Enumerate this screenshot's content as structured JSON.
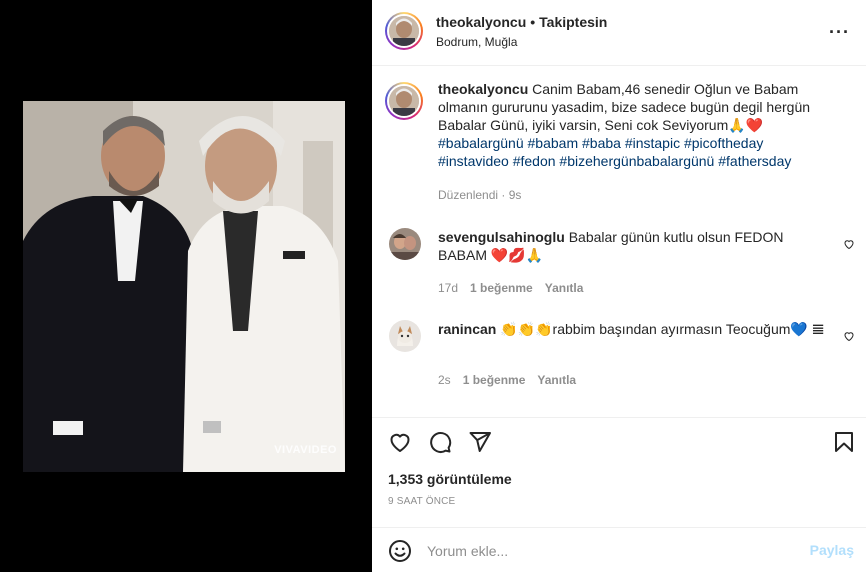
{
  "post": {
    "username": "theokalyoncu",
    "follow_status": "Takiptesin",
    "location": "Bodrum, Muğla",
    "watermark": "VIVAVIDEO"
  },
  "caption": {
    "username": "theokalyoncu",
    "text": "Canim Babam,46 senedir Oğlun ve Babam olmanın gururunu yasadim, bize sadece bugün degil hergün Babalar Günü, iyiki varsin, Seni cok Seviyorum🙏❤️",
    "hashtags": "#babalargünü #babam #baba #instapic #picoftheday #instavideo #fedon #bizehergünbabalargünü #fathersday",
    "edited": "Düzenlendi",
    "age": "9s"
  },
  "comments": [
    {
      "username": "sevengulsahinoglu",
      "text": "Babalar günün kutlu olsun FEDON BABAM ❤️💋🙏",
      "age": "17d",
      "likes": "1 beğenme",
      "reply": "Yanıtla"
    },
    {
      "username": "ranincan",
      "text": "👏👏👏rabbim başından ayırmasın Teocuğum💙 𝌆",
      "age": "2s",
      "likes": "1 beğenme",
      "reply": "Yanıtla"
    }
  ],
  "stats": {
    "views": "1,353 görüntüleme",
    "time_ago": "9 saat önce"
  },
  "add_comment": {
    "placeholder": "Yorum ekle...",
    "share_label": "Paylaş"
  },
  "icons": {
    "more": "more-horizontal-icon",
    "like": "heart-icon",
    "comment": "comment-icon",
    "share": "send-icon",
    "save": "bookmark-icon",
    "emoji": "emoji-icon"
  },
  "colors": {
    "hashtag": "#00376b",
    "share_disabled": "#b2dffc",
    "meta_gray": "#8e8e8e"
  }
}
